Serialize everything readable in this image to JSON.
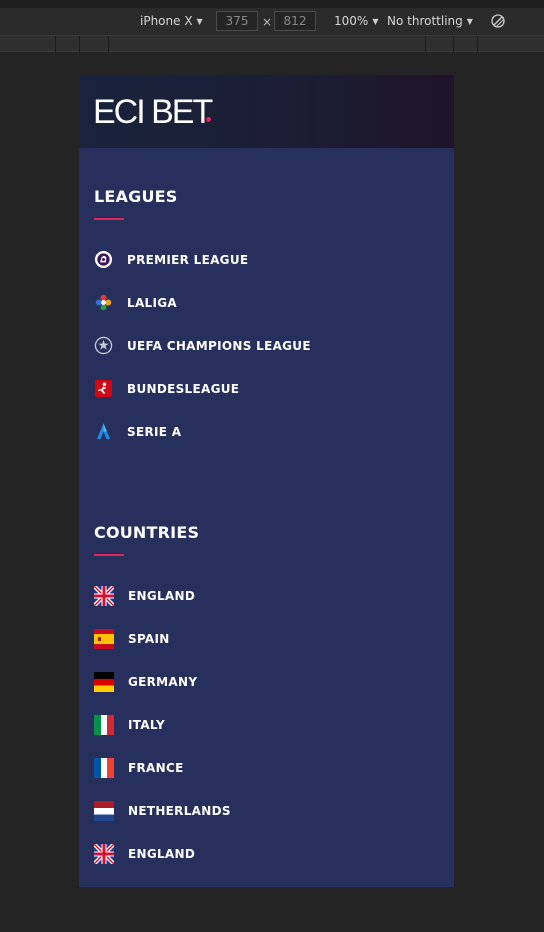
{
  "devtools": {
    "device": "iPhone X",
    "width": "375",
    "height": "812",
    "times": "×",
    "zoom": "100%",
    "throttling": "No throttling"
  },
  "site": {
    "logo": "ECI BET",
    "accent_color": "#e0245e"
  },
  "leagues": {
    "title": "LEAGUES",
    "items": [
      {
        "label": "PREMIER LEAGUE",
        "icon": "premier-league-icon"
      },
      {
        "label": "LALIGA",
        "icon": "laliga-icon"
      },
      {
        "label": "UEFA CHAMPIONS LEAGUE",
        "icon": "champions-league-icon"
      },
      {
        "label": "BUNDESLEAGUE",
        "icon": "bundesliga-icon"
      },
      {
        "label": "SERIE A",
        "icon": "serie-a-icon"
      }
    ]
  },
  "countries": {
    "title": "COUNTRIES",
    "items": [
      {
        "label": "ENGLAND",
        "icon": "uk-flag-icon"
      },
      {
        "label": "SPAIN",
        "icon": "spain-flag-icon"
      },
      {
        "label": "GERMANY",
        "icon": "germany-flag-icon"
      },
      {
        "label": "ITALY",
        "icon": "italy-flag-icon"
      },
      {
        "label": "FRANCE",
        "icon": "france-flag-icon"
      },
      {
        "label": "NETHERLANDS",
        "icon": "netherlands-flag-icon"
      },
      {
        "label": "ENGLAND",
        "icon": "uk-flag-icon"
      }
    ]
  }
}
